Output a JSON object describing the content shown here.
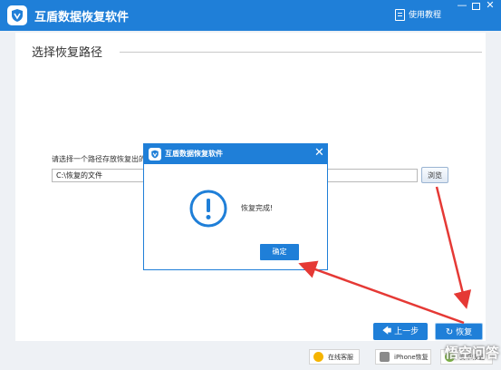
{
  "app": {
    "title": "互盾数据恢复软件",
    "help_label": "使用教程",
    "minimize_glyph": "—",
    "close_glyph": "✕"
  },
  "section": {
    "title": "选择恢复路径",
    "path_label": "请选择一个路径存放恢复出的文件",
    "path_value": "C:\\恢复的文件",
    "browse_label": "浏览"
  },
  "nav": {
    "prev_label": "上一步",
    "recover_label": "恢复"
  },
  "footer": {
    "online_service": "在线客服",
    "iphone_recovery": "iPhone恢复",
    "android_recovery": "安卓恢复"
  },
  "watermark": "悟空问答",
  "dialog": {
    "title": "互盾数据恢复软件",
    "message": "恢复完成!",
    "ok_label": "确定",
    "close_glyph": "✕"
  },
  "colors": {
    "accent": "#1f7fd8",
    "annotation_arrow": "#e53935"
  }
}
